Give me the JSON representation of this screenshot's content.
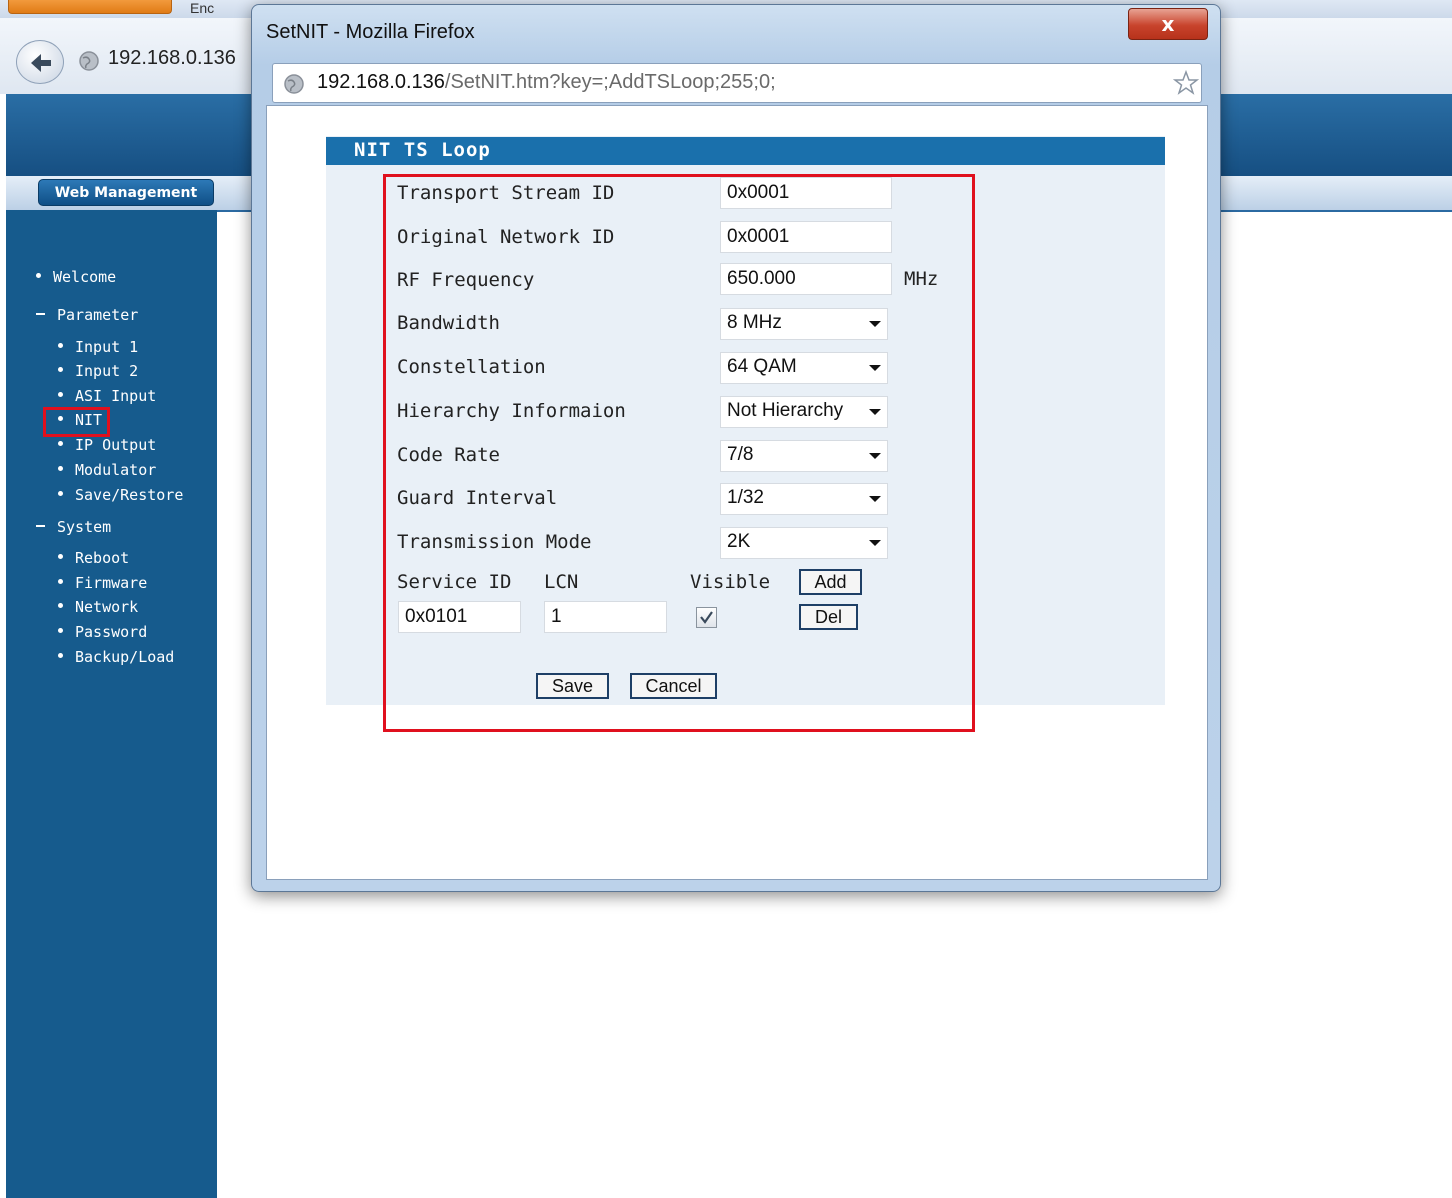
{
  "background_browser": {
    "tab_text": "Enc",
    "address": "192.168.0.136"
  },
  "header": {
    "web_management": "Web Management"
  },
  "sidebar": {
    "welcome": "Welcome",
    "parameter": "Parameter",
    "parameter_items": [
      "Input 1",
      "Input 2",
      "ASI Input",
      "NIT",
      "IP Output",
      "Modulator",
      "Save/Restore"
    ],
    "system": "System",
    "system_items": [
      "Reboot",
      "Firmware",
      "Network",
      "Password",
      "Backup/Load"
    ],
    "selected": "NIT"
  },
  "popup": {
    "title": "SetNIT - Mozilla Firefox",
    "close_symbol": "x",
    "url_host": "192.168.0.136",
    "url_path": "/SetNIT.htm?key=;AddTSLoop;255;0;"
  },
  "form": {
    "title": "NIT TS Loop",
    "transport_stream_id": {
      "label": "Transport Stream ID",
      "value": "0x0001"
    },
    "original_network_id": {
      "label": "Original Network ID",
      "value": "0x0001"
    },
    "rf_frequency": {
      "label": "RF Frequency",
      "value": "650.000",
      "unit": "MHz"
    },
    "bandwidth": {
      "label": "Bandwidth",
      "value": "8 MHz"
    },
    "constellation": {
      "label": "Constellation",
      "value": "64 QAM"
    },
    "hierarchy": {
      "label": "Hierarchy Informaion",
      "value": "Not Hierarchy"
    },
    "code_rate": {
      "label": "Code Rate",
      "value": "7/8"
    },
    "guard_interval": {
      "label": "Guard Interval",
      "value": "1/32"
    },
    "transmission_mode": {
      "label": "Transmission Mode",
      "value": "2K"
    },
    "service_id_label": "Service ID",
    "lcn_label": "LCN",
    "visible_label": "Visible",
    "service_id_value": "0x0101",
    "lcn_value": "1",
    "visible_checked": true,
    "add_button": "Add",
    "del_button": "Del",
    "save_button": "Save",
    "cancel_button": "Cancel"
  },
  "colors": {
    "sidebar": "#165b8d",
    "form_header": "#1a70ac",
    "highlight": "#e0101e"
  }
}
